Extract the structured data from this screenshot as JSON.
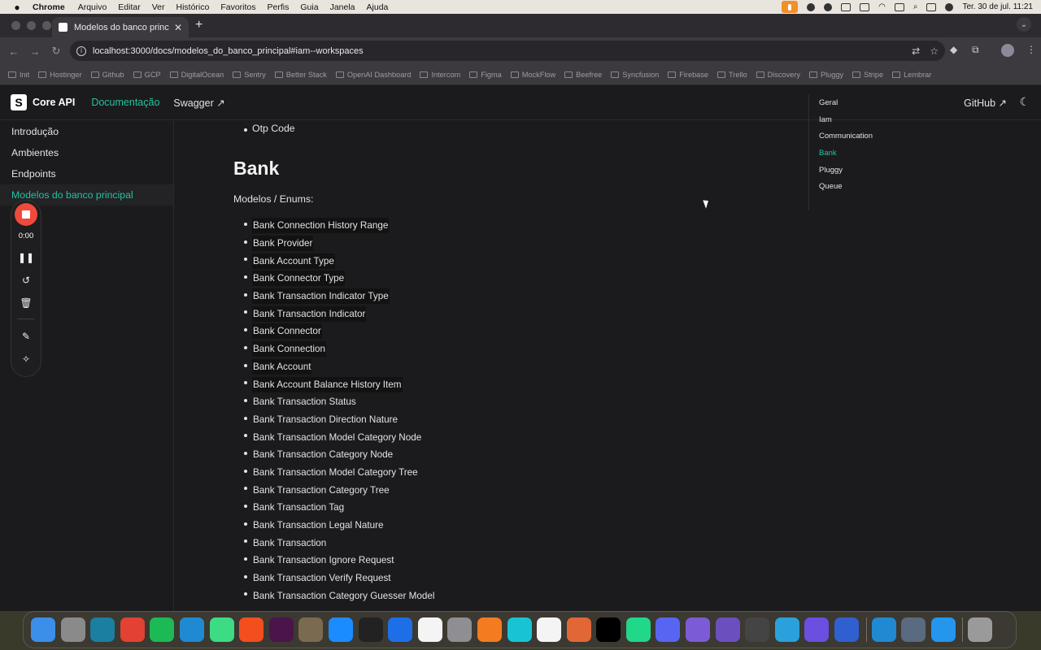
{
  "menubar": {
    "app": "Chrome",
    "items": [
      "Arquivo",
      "Editar",
      "Ver",
      "Histórico",
      "Favoritos",
      "Perfis",
      "Guia",
      "Janela",
      "Ajuda"
    ],
    "datetime": "Ter. 30 de jul.  11:21"
  },
  "browser": {
    "tab_title": "Modelos do banco principal |",
    "url": "localhost:3000/docs/modelos_do_banco_principal#iam--workspaces",
    "bookmarks": [
      "Init",
      "Hostinger",
      "Github",
      "GCP",
      "DigitalOcean",
      "Sentry",
      "Better Stack",
      "OpenAI Dashboard",
      "Intercom",
      "Figma",
      "MockFlow",
      "Beefree",
      "Syncfusion",
      "Firebase",
      "Trello",
      "Discovery",
      "Pluggy",
      "Stripe",
      "Lembrar"
    ]
  },
  "site": {
    "brand": "Core API",
    "nav": {
      "docs": "Documentação",
      "swagger": "Swagger ↗",
      "github": "GitHub ↗"
    },
    "sidebar": [
      "Introdução",
      "Ambientes",
      "Endpoints",
      "Modelos do banco principal"
    ],
    "prev_item": "Otp Code",
    "heading": "Bank",
    "subtitle": "Modelos / Enums:",
    "items": [
      "Bank Connection History Range",
      "Bank Provider",
      "Bank Account Type",
      "Bank Connector Type",
      "Bank Transaction Indicator Type",
      "Bank Transaction Indicator",
      "Bank Connector",
      "Bank Connection",
      "Bank Account",
      "Bank Account Balance History Item",
      "Bank Transaction Status",
      "Bank Transaction Direction Nature",
      "Bank Transaction Model Category Node",
      "Bank Transaction Category Node",
      "Bank Transaction Model Category Tree",
      "Bank Transaction Category Tree",
      "Bank Transaction Tag",
      "Bank Transaction Legal Nature",
      "Bank Transaction",
      "Bank Transaction Ignore Request",
      "Bank Transaction Verify Request",
      "Bank Transaction Category Guesser Model"
    ],
    "toc": [
      "Geral",
      "Iam",
      "Communication",
      "Bank",
      "Pluggy",
      "Queue"
    ]
  },
  "recorder": {
    "time": "0:00"
  },
  "dock": {
    "apps": [
      {
        "name": "finder",
        "color": "#3b8fe8"
      },
      {
        "name": "launchpad",
        "color": "#8a8a8a"
      },
      {
        "name": "app",
        "color": "#1a7fa0"
      },
      {
        "name": "chrome",
        "color": "#e34133"
      },
      {
        "name": "spotify",
        "color": "#1db954"
      },
      {
        "name": "vscode",
        "color": "#1f8ad2"
      },
      {
        "name": "android-studio",
        "color": "#3ddc84"
      },
      {
        "name": "figma",
        "color": "#f24e1e"
      },
      {
        "name": "slack",
        "color": "#4a154b"
      },
      {
        "name": "gimp",
        "color": "#7a6a50"
      },
      {
        "name": "app-store",
        "color": "#1a8cff"
      },
      {
        "name": "terminal",
        "color": "#222222"
      },
      {
        "name": "xcode",
        "color": "#1e6ee8"
      },
      {
        "name": "notion",
        "color": "#f4f4f4"
      },
      {
        "name": "settings",
        "color": "#8e8e93"
      },
      {
        "name": "fusion",
        "color": "#f37b20"
      },
      {
        "name": "cursor",
        "color": "#18c4d4"
      },
      {
        "name": "mongodb",
        "color": "#f4f4f4"
      },
      {
        "name": "matlab",
        "color": "#e16737"
      },
      {
        "name": "intellij",
        "color": "#000000"
      },
      {
        "name": "datagrip",
        "color": "#21d789"
      },
      {
        "name": "discord",
        "color": "#5865f2"
      },
      {
        "name": "app2",
        "color": "#7b5cd6"
      },
      {
        "name": "app3",
        "color": "#6b4fbf"
      },
      {
        "name": "unity",
        "color": "#444444"
      },
      {
        "name": "telegram",
        "color": "#2aa1da"
      },
      {
        "name": "app4",
        "color": "#6a4fe0"
      },
      {
        "name": "app5",
        "color": "#3060d0"
      }
    ],
    "apps_right": [
      {
        "name": "vscode",
        "color": "#1f8ad2"
      },
      {
        "name": "app6",
        "color": "#5a6a80"
      },
      {
        "name": "docker",
        "color": "#2496ed"
      }
    ],
    "trash": {
      "name": "trash",
      "color": "#9a9a9a"
    }
  }
}
